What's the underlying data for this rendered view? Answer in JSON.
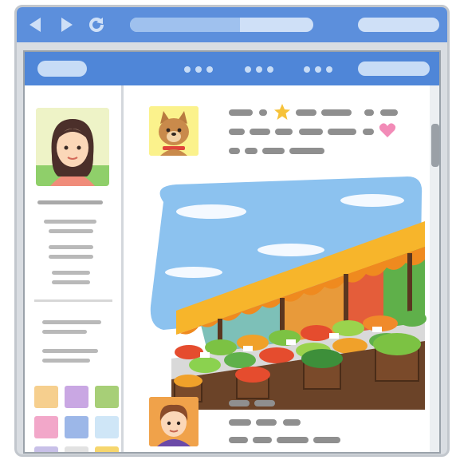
{
  "browser": {
    "nav_icons": [
      "back-arrow-icon",
      "forward-arrow-icon",
      "reload-icon"
    ],
    "address_progress": 0.6
  },
  "colors": {
    "chrome_blue": "#5c8fdc",
    "header_blue": "#4f86d8",
    "sky_blue": "#8cc2ef",
    "awning_yellow": "#f7b52b",
    "awning_orange": "#ef8a1f",
    "star": "#f6c23a",
    "heart": "#f28bb7"
  },
  "post1": {
    "avatar_icon": "dog-icon",
    "badges": [
      "star-icon",
      "heart-icon"
    ],
    "image_subject": "market-stall-photo"
  },
  "post2": {
    "avatar_icon": "boy-avatar-icon"
  },
  "sidebar": {
    "profile_icon": "woman-avatar-icon",
    "swatch_colors": [
      "#f6cf8e",
      "#c9a7e3",
      "#a7cf77",
      "#f2a7c9",
      "#9cb7e8",
      "#cfe6f7",
      "#c8c0e8",
      "#e2e2e2",
      "#f6d66d"
    ]
  }
}
